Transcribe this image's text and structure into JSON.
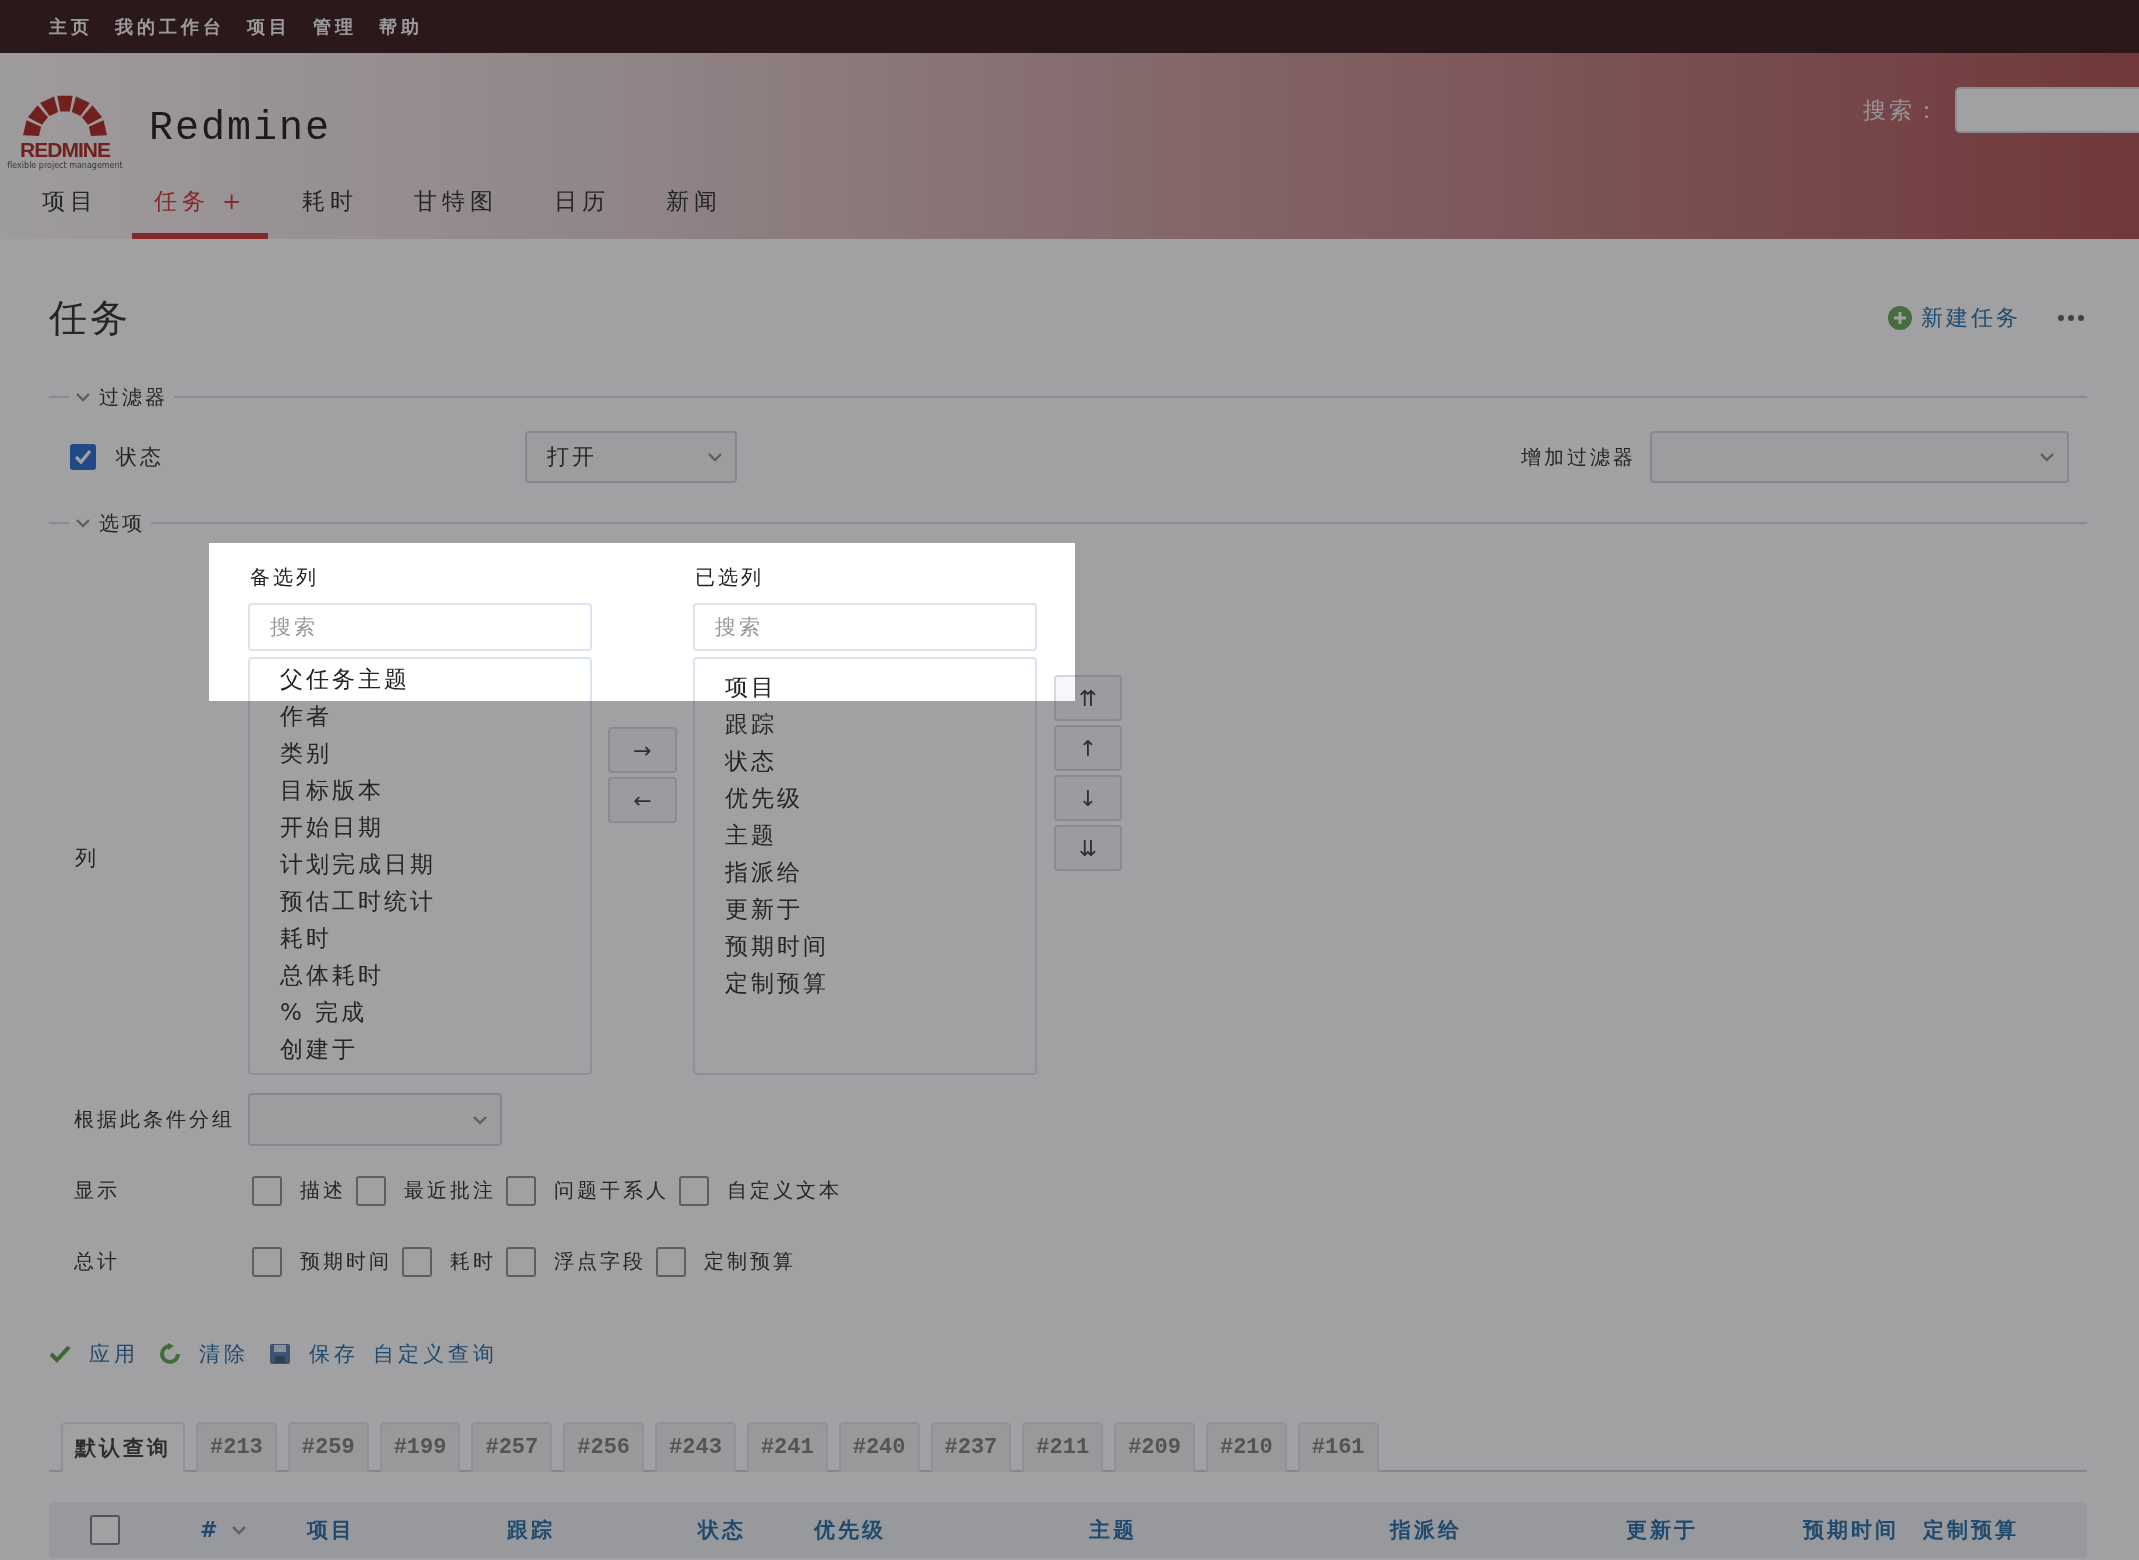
{
  "top_menu": [
    {
      "label": "主页"
    },
    {
      "label": "我的工作台"
    },
    {
      "label": "项目"
    },
    {
      "label": "管理"
    },
    {
      "label": "帮助"
    }
  ],
  "header": {
    "logo_text": "REDMINE",
    "logo_tagline": "flexible project management",
    "title": "Redmine",
    "search_label": "搜索："
  },
  "main_tabs": [
    {
      "label": "项目",
      "selected": false
    },
    {
      "label": "任务",
      "selected": true,
      "add": "+"
    },
    {
      "label": "耗时",
      "selected": false
    },
    {
      "label": "甘特图",
      "selected": false
    },
    {
      "label": "日历",
      "selected": false
    },
    {
      "label": "新闻",
      "selected": false
    }
  ],
  "page_title": "任务",
  "new_issue": {
    "label": "新建任务"
  },
  "filters": {
    "legend": "过滤器",
    "expanded": true,
    "rows": [
      {
        "label": "状态",
        "checked": true,
        "value": "打开"
      }
    ],
    "add_filter_label": "增加过滤器"
  },
  "options": {
    "legend": "选项",
    "expanded": true,
    "columns_label": "列",
    "available": {
      "label": "备选列",
      "placeholder": "搜索",
      "items": [
        "父任务主题",
        "作者",
        "类别",
        "目标版本",
        "开始日期",
        "计划完成日期",
        "预估工时统计",
        "耗时",
        "总体耗时",
        "%  完成",
        "创建于"
      ]
    },
    "selected": {
      "label": "已选列",
      "placeholder": "搜索",
      "items": [
        "项目",
        "跟踪",
        "状态",
        "优先级",
        "主题",
        "指派给",
        "更新于",
        "预期时间",
        "定制预算"
      ]
    },
    "move_buttons": [
      "→",
      "←"
    ],
    "order_buttons": [
      "⇈",
      "↑",
      "↓",
      "⇊"
    ],
    "group_by_label": "根据此条件分组",
    "display": {
      "label": "显示",
      "items": [
        {
          "label": "描述",
          "checked": false
        },
        {
          "label": "最近批注",
          "checked": false
        },
        {
          "label": "问题干系人",
          "checked": false
        },
        {
          "label": "自定义文本",
          "checked": false
        }
      ]
    },
    "totals": {
      "label": "总计",
      "items": [
        {
          "label": "预期时间",
          "checked": false
        },
        {
          "label": "耗时",
          "checked": false
        },
        {
          "label": "浮点字段",
          "checked": false
        },
        {
          "label": "定制预算",
          "checked": false
        }
      ]
    }
  },
  "query_actions": [
    {
      "kind": "apply",
      "label": "应用"
    },
    {
      "kind": "clear",
      "label": "清除"
    },
    {
      "kind": "save",
      "label": "保存"
    },
    {
      "kind": "link",
      "label": "自定义查询"
    }
  ],
  "query_tabs": [
    {
      "label": "默认查询",
      "selected": true
    },
    {
      "label": "#213",
      "selected": false
    },
    {
      "label": "#259",
      "selected": false
    },
    {
      "label": "#199",
      "selected": false
    },
    {
      "label": "#257",
      "selected": false
    },
    {
      "label": "#256",
      "selected": false
    },
    {
      "label": "#243",
      "selected": false
    },
    {
      "label": "#241",
      "selected": false
    },
    {
      "label": "#240",
      "selected": false
    },
    {
      "label": "#237",
      "selected": false
    },
    {
      "label": "#211",
      "selected": false
    },
    {
      "label": "#209",
      "selected": false
    },
    {
      "label": "#210",
      "selected": false
    },
    {
      "label": "#161",
      "selected": false
    }
  ],
  "table": {
    "select_all": {
      "checked": false
    },
    "columns": [
      {
        "label": "#",
        "sorted": true
      },
      {
        "label": "项目"
      },
      {
        "label": "跟踪"
      },
      {
        "label": "状态"
      },
      {
        "label": "优先级"
      },
      {
        "label": "主题"
      },
      {
        "label": "指派给"
      },
      {
        "label": "更新于"
      },
      {
        "label": "预期时间"
      },
      {
        "label": "定制预算"
      }
    ]
  }
}
